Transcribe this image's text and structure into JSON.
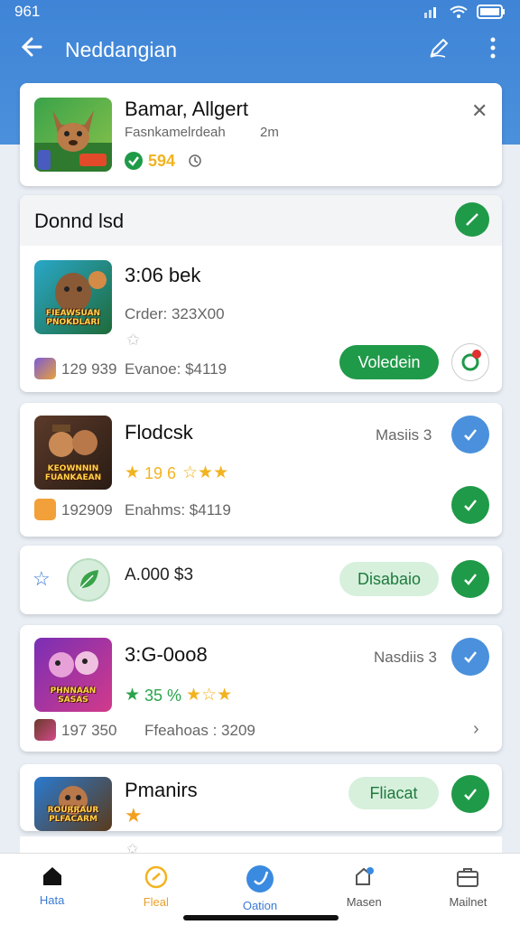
{
  "status_bar": {
    "time": "961"
  },
  "app_bar": {
    "title": "Neddangian"
  },
  "header_card": {
    "name": "Bamar, Allgert",
    "subtitle": "Fasnkamelrdeah",
    "time": "2m",
    "score": "594"
  },
  "section": {
    "title": "Donnd lsd"
  },
  "items": [
    {
      "title": "3:06 bek",
      "detail": "Crder: 323X00",
      "thumb_label": "FIEAWSUAN PNOKDLARI",
      "count": "129 939",
      "price": "Evanoe: $4119",
      "button": "Voledein"
    },
    {
      "title": "Flodcsk",
      "status": "Masiis 3",
      "rating": "19 6",
      "thumb_label": "KEOWNNIN FUANKAEAN",
      "count": "192909",
      "price": "Enahms: $4119"
    },
    {
      "title": "A.000 $3",
      "button": "Disabaio"
    },
    {
      "title": "3:G-0oo8",
      "status": "Nasdiis 3",
      "rating": "35 %",
      "thumb_label": "PHNNAAN SASAS",
      "count": "197 350",
      "price": "Ffeahoas : 3209"
    },
    {
      "title": "Pmanirs",
      "thumb_label": "ROURRAUR PLFACARM",
      "button": "Fliacat"
    }
  ],
  "bottom_nav": [
    {
      "label": "Hata"
    },
    {
      "label": "Fleal"
    },
    {
      "label": "Oation"
    },
    {
      "label": "Masen"
    },
    {
      "label": "Mailnet"
    }
  ],
  "colors": {
    "header_blue": "#3f84d6",
    "accent_green": "#1f9a48",
    "accent_blue": "#4a90dc",
    "star_yellow": "#f2b320"
  }
}
